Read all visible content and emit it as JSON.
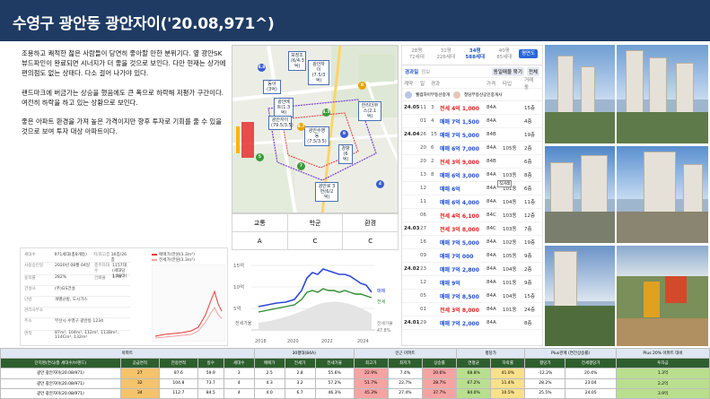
{
  "title": "수영구 광안동 광안자이('20.08,971^)",
  "description": [
    "조용하고 쾌적한 젊은 사람들이 당연히 좋아할 만한 분위기다. 옆 광안SK뷰드파인이 완료되면 시너지가 더 좋을 것으로 보인다. 다만 현재는 상가에 편의점도 없는 상태다. 다소 걸어 나가야 있다.",
    "랜드마크에 버금가는 상승을 했음에도 큰 폭으로 하락해 저평가 구간이다. 여전히 하락을 하고 있는 상황으로 보인다.",
    "좋은 아파트 환경을 가져 높은 가격이지만 향후 투자로 기회를 줄 수 있을 것으로 보여 투자 대상 아파트이다."
  ],
  "map": {
    "pins": [
      "포장조(6/4.3억)",
      "광안자이(7.5/3억)",
      "동아(3억)",
      "광안메트(1.3억)",
      "광안자이(79.5/3.5)",
      "광안수영동(7.5/3.5)",
      "한리더무스(2.1억)",
      "경향(6억)",
      "광안로 3번(6/2억)"
    ],
    "dots": [
      "4.8",
      "8.7",
      "9",
      "4.5",
      "5",
      "7",
      "8",
      "4"
    ]
  },
  "grades": {
    "headers": [
      "교통",
      "학군",
      "환경"
    ],
    "values": [
      "A",
      "C",
      "C"
    ]
  },
  "listing": {
    "area_tabs": [
      {
        "line1": "28평",
        "line2": "72세대"
      },
      {
        "line1": "31평",
        "line2": "226세대"
      },
      {
        "line1": "34평",
        "line2": "588세대"
      },
      {
        "line1": "40평",
        "line2": "85세대"
      }
    ],
    "brochure_btn": "평면도",
    "subtabs": [
      "경과일",
      "정보"
    ],
    "badges": [
      "동일매물 묶기",
      "전체"
    ],
    "col_headers": [
      "계약",
      "일",
      "경과",
      "가격",
      "타입",
      "거래동"
    ],
    "brokers": [
      "웰컴자이부동산중개",
      "청담부동산공인중개사"
    ],
    "rows": [
      {
        "date": "24.05",
        "day": "11",
        "floor": "3",
        "price": "전세 4억 1,000",
        "kind": "jeon",
        "area": "84A",
        "dong": "",
        "fl": "15층"
      },
      {
        "date": "",
        "day": "01",
        "floor": "4",
        "price": "매매 7억 1,500",
        "kind": "sale",
        "area": "84A",
        "dong": "",
        "fl": "4층"
      },
      {
        "date": "24.04",
        "day": "26",
        "floor": "15",
        "price": "매매 7억 5,000",
        "kind": "sale",
        "area": "84B",
        "dong": "",
        "fl": "19층"
      },
      {
        "date": "",
        "day": "20",
        "floor": "6",
        "price": "매매 6억 7,000",
        "kind": "sale",
        "area": "84A",
        "dong": "105동",
        "fl": "2층"
      },
      {
        "date": "",
        "day": "20",
        "floor": "2",
        "price": "전세 3억 9,000",
        "kind": "jeon",
        "area": "84B",
        "dong": "",
        "fl": "6층"
      },
      {
        "date": "",
        "day": "13",
        "floor": "8",
        "price": "매매 6억 3,000",
        "kind": "sale",
        "area": "84A",
        "dong": "103동",
        "fl": "8층"
      },
      {
        "date": "",
        "day": "12",
        "floor": "",
        "price": "매매 6억",
        "kind": "sale",
        "area": "84A",
        "dong": "101동",
        "fl": "6층",
        "tag": "직거래"
      },
      {
        "date": "",
        "day": "11",
        "floor": "",
        "price": "매매 6억 4,000",
        "kind": "sale",
        "area": "84A",
        "dong": "104동",
        "fl": "11층"
      },
      {
        "date": "",
        "day": "06",
        "floor": "",
        "price": "전세 4억 6,100",
        "kind": "jeon",
        "area": "84C",
        "dong": "103동",
        "fl": "12층"
      },
      {
        "date": "24.03",
        "day": "27",
        "floor": "",
        "price": "전세 3억 8,000",
        "kind": "jeon",
        "area": "84C",
        "dong": "103동",
        "fl": "7층"
      },
      {
        "date": "",
        "day": "16",
        "floor": "",
        "price": "매매 7억 5,000",
        "kind": "sale",
        "area": "84A",
        "dong": "102동",
        "fl": "19층"
      },
      {
        "date": "",
        "day": "09",
        "floor": "",
        "price": "매매 7억 000",
        "kind": "sale",
        "area": "84A",
        "dong": "105동",
        "fl": "9층"
      },
      {
        "date": "24.02",
        "day": "23",
        "floor": "",
        "price": "매매 7억 2,800",
        "kind": "sale",
        "area": "84A",
        "dong": "104동",
        "fl": "2층"
      },
      {
        "date": "",
        "day": "12",
        "floor": "",
        "price": "매매 9억",
        "kind": "sale",
        "area": "84A",
        "dong": "101동",
        "fl": "9층"
      },
      {
        "date": "",
        "day": "05",
        "floor": "",
        "price": "매매 7억 8,500",
        "kind": "sale",
        "area": "84A",
        "dong": "104동",
        "fl": "15층"
      },
      {
        "date": "",
        "day": "01",
        "floor": "",
        "price": "전세 3억 8,000",
        "kind": "jeon",
        "area": "84A",
        "dong": "101동",
        "fl": "24층"
      },
      {
        "date": "24.01",
        "day": "29",
        "floor": "",
        "price": "매매 7억 2,000",
        "kind": "sale",
        "area": "84A",
        "dong": "",
        "fl": "8층"
      }
    ]
  },
  "info_card": {
    "rows": [
      [
        "세대수",
        "971세대(총8개동)",
        "저/최고층",
        "16층/26층"
      ],
      [
        "사용승인일",
        "2020년 08월 04일",
        "총주차대수",
        "1157대(세대당 1.19대)"
      ],
      [
        "용적률",
        "282%",
        "건폐율",
        "17%"
      ],
      [
        "건설사",
        "(주)GS건설",
        "",
        ""
      ],
      [
        "난방",
        "개별난방, 도시가스",
        "",
        ""
      ],
      [
        "관리사무소",
        "",
        "",
        ""
      ],
      [
        "주소",
        "부산시 수영구 광안동 1234",
        "",
        ""
      ],
      [
        "면적",
        "87m², 104m², 112m², 113Bm², 114Cm², 132m²",
        "",
        ""
      ]
    ],
    "legend": [
      "매매가(만원/3.3m²)",
      "전세가(만원/3.3m²)"
    ]
  },
  "price_chart": {
    "y_ticks": [
      "15억",
      "10억",
      "5억",
      "0"
    ],
    "x_ticks": [
      "2018",
      "2020",
      "2022",
      "2024"
    ],
    "right_labels": [
      "매매",
      "전세",
      "전세가율",
      "47.8%"
    ],
    "bottom_left": "전세가율"
  },
  "bottom_table": {
    "group_headers": [
      "아파트",
      "30평대(84A)",
      "인근 아파트",
      "평당가",
      "Plus관계 (연간상승률)",
      "Plus 20% 아파트 대비"
    ],
    "col_headers": [
      "단지명(연식/총 세대수/브랜드)",
      "공급면적",
      "전용면적",
      "방수",
      "세대수",
      "매매가",
      "전세가",
      "전세가율",
      "최고가",
      "최저가",
      "상승률",
      "연평균",
      "하락률",
      "평당가",
      "전세평당가",
      "투자금"
    ],
    "rows": [
      [
        "광안 광안자이(20.08/971)",
        "27",
        "87.6",
        "59.9",
        "3",
        "2.5",
        "2.8",
        "55.6%",
        "22.9%",
        "7.4%",
        "20.6%",
        "68.8%",
        "41.0%",
        "-12.2%",
        "20.4%",
        "1.3억"
      ],
      [
        "광안 광안자이(20.08/971)",
        "32",
        "104.8",
        "73.7",
        "4",
        "4.3",
        "3.2",
        "57.2%",
        "51.7%",
        "22.7%",
        "28.7%",
        "67.2%",
        "11.4%",
        "28.2%",
        "23.04",
        "2.2억"
      ],
      [
        "광안 광안자이(20.08/971)",
        "34",
        "112.7",
        "84.5",
        "4",
        "4.0",
        "6.7",
        "46.3%",
        "45.3%",
        "27.4%",
        "37.7%",
        "84.0%",
        "10.5%",
        "25.5%",
        "24.05",
        "3.9억"
      ]
    ]
  }
}
